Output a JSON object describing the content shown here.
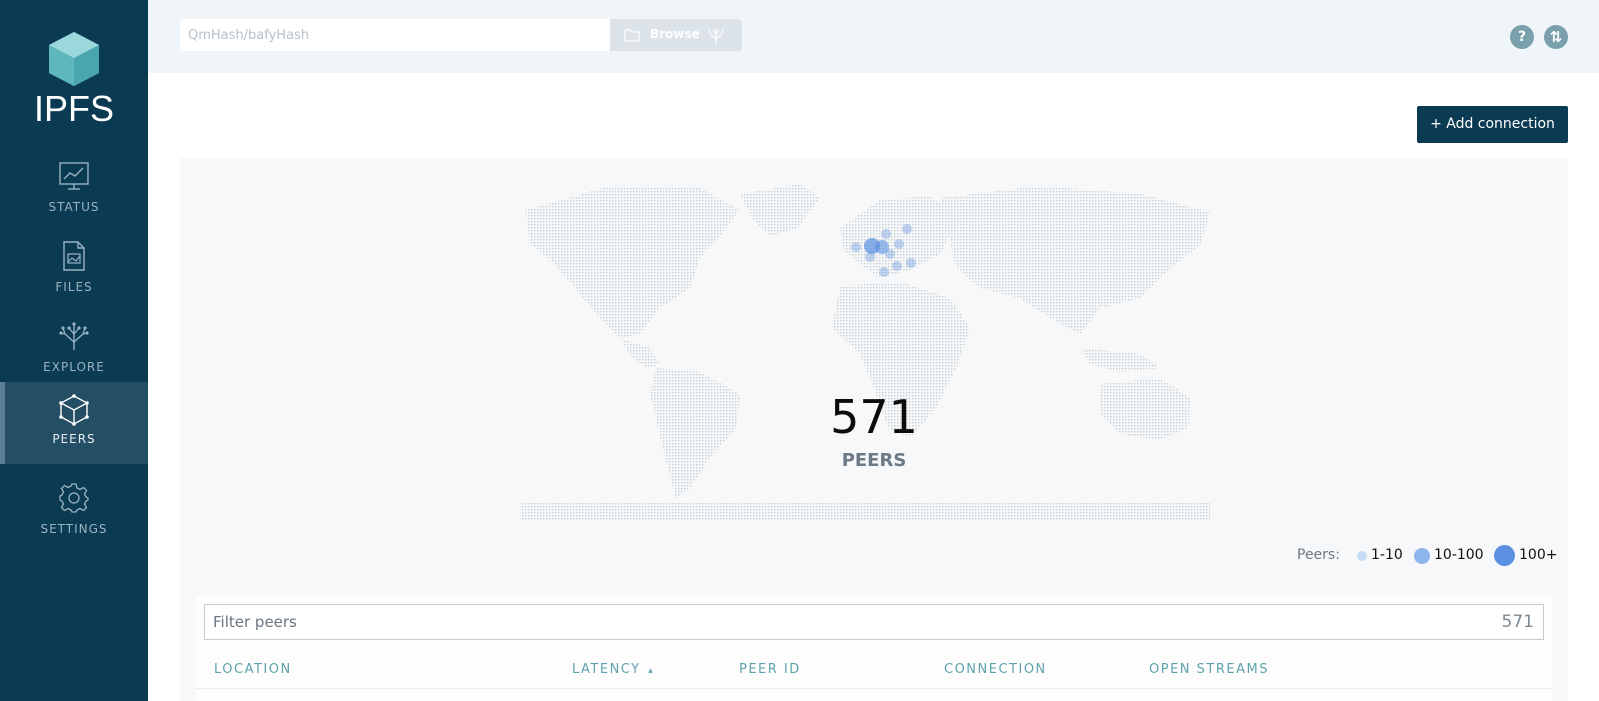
{
  "app": {
    "logo_text": "IPFS"
  },
  "sidebar": {
    "items": [
      {
        "label": "STATUS",
        "icon": "status-chart-icon"
      },
      {
        "label": "FILES",
        "icon": "files-icon"
      },
      {
        "label": "EXPLORE",
        "icon": "explore-tree-icon"
      },
      {
        "label": "PEERS",
        "icon": "peers-cube-icon",
        "active": true
      },
      {
        "label": "SETTINGS",
        "icon": "gear-icon"
      }
    ]
  },
  "topbar": {
    "search_placeholder": "QmHash/bafyHash",
    "browse_label": "Browse",
    "help_glyph": "?",
    "connection_glyph": "⇅"
  },
  "actions": {
    "add_connection_label": "+ Add connection"
  },
  "map": {
    "peer_count": "571",
    "peer_word": "PEERS",
    "legend": {
      "title": "Peers:",
      "items": [
        {
          "label": "1-10",
          "color": "#c5dcf6"
        },
        {
          "label": "10-100",
          "color": "#8db5ec"
        },
        {
          "label": "100+",
          "color": "#5a8fe2"
        }
      ]
    }
  },
  "table": {
    "filter_placeholder": "Filter peers",
    "filter_count": "571",
    "columns": [
      "LOCATION",
      "LATENCY",
      "PEER ID",
      "CONNECTION",
      "OPEN STREAMS"
    ],
    "sort_indicator": "▴"
  },
  "colors": {
    "sidebar_bg": "#0b3a53",
    "accent": "#5ea2ad",
    "peer_dot": "#5a8fe2"
  }
}
